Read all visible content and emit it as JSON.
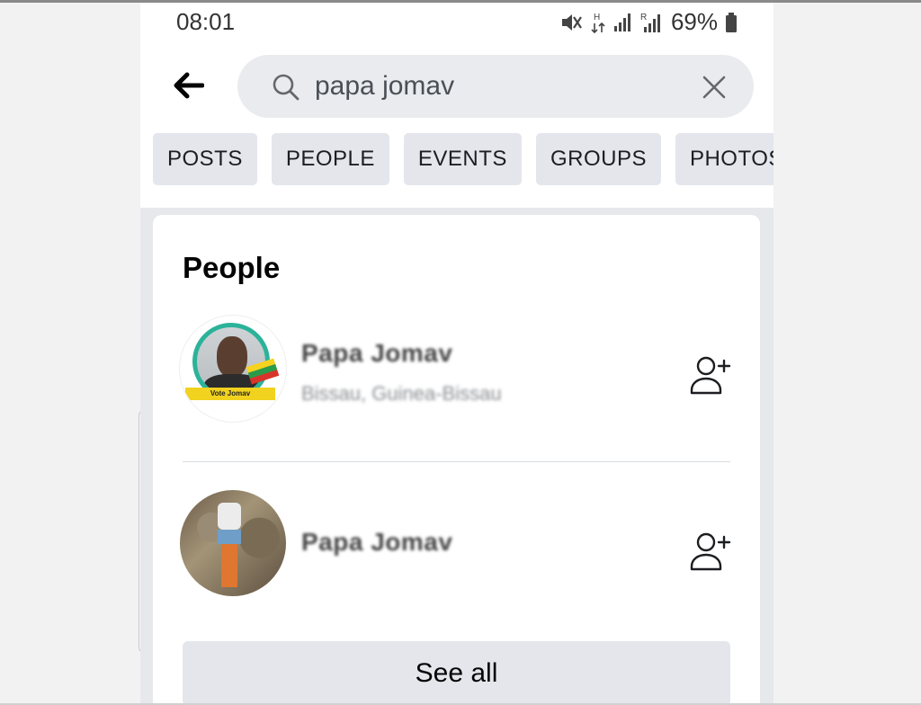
{
  "status_bar": {
    "time": "08:01",
    "battery_percent": "69%"
  },
  "search": {
    "query": "papa jomav"
  },
  "filter_tabs": [
    {
      "label": "POSTS"
    },
    {
      "label": "PEOPLE"
    },
    {
      "label": "EVENTS"
    },
    {
      "label": "GROUPS"
    },
    {
      "label": "PHOTOS"
    }
  ],
  "people_section": {
    "title": "People",
    "results": [
      {
        "name": "Papa Jomav",
        "location": "Bissau, Guinea-Bissau",
        "avatar_banner": "Vote Jomav"
      },
      {
        "name": "Papa Jomav",
        "location": ""
      }
    ],
    "see_all_label": "See all"
  },
  "icons": {
    "back": "arrow-left-icon",
    "search": "search-icon",
    "clear": "close-icon",
    "add_friend": "add-friend-icon"
  }
}
